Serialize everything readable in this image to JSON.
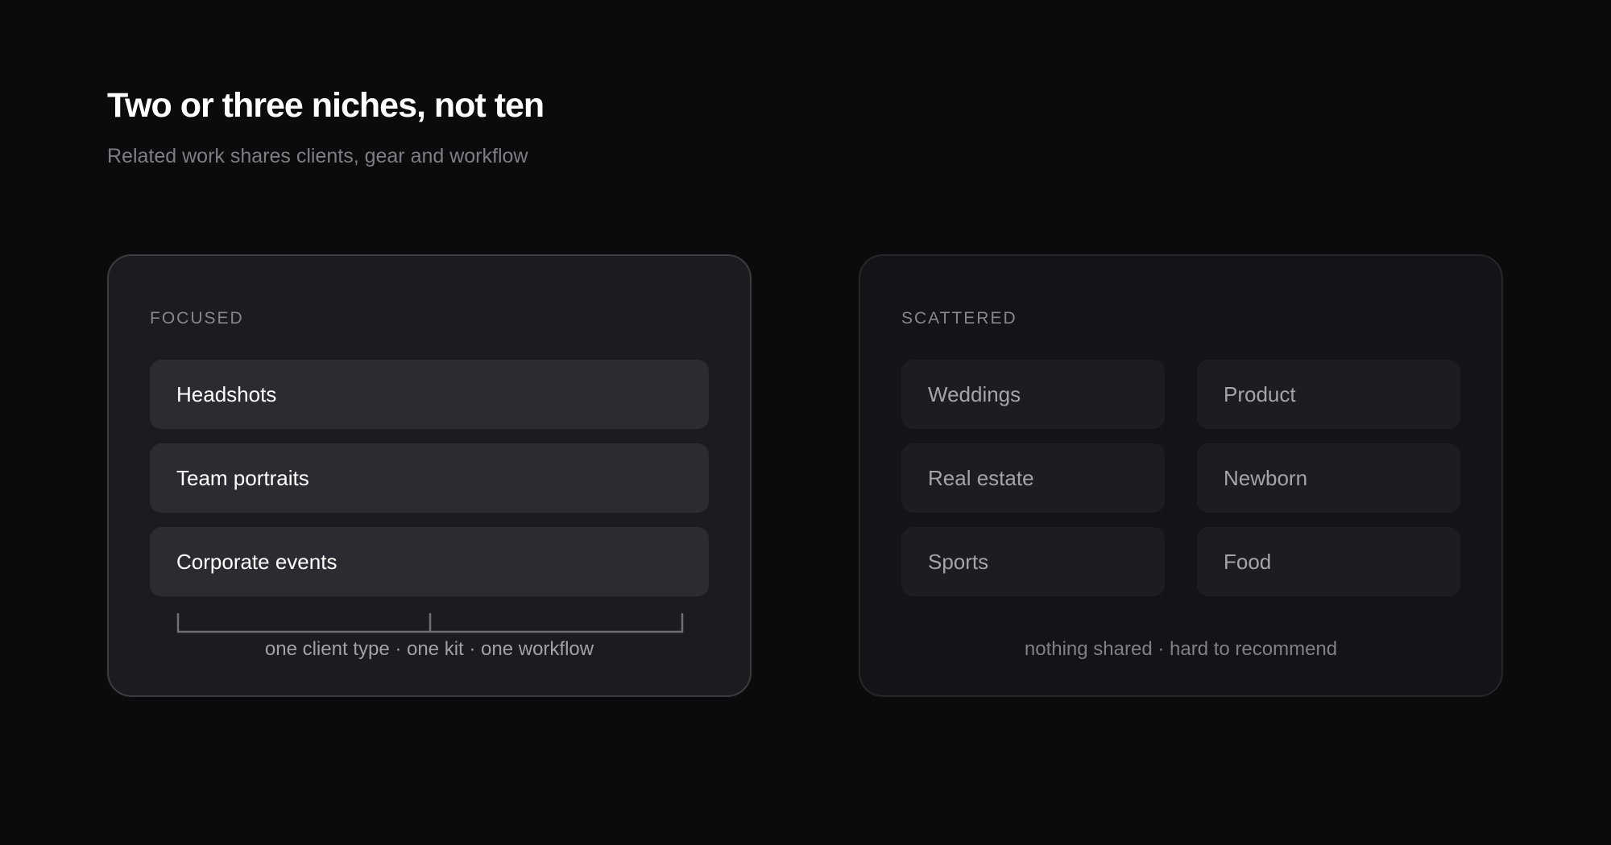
{
  "header": {
    "title": "Two or three niches, not ten",
    "subtitle": "Related work shares clients, gear and workflow"
  },
  "focused": {
    "label": "FOCUSED",
    "items": [
      "Headshots",
      "Team portraits",
      "Corporate events"
    ],
    "caption": "one client type · one kit · one workflow"
  },
  "scattered": {
    "label": "SCATTERED",
    "items": [
      "Weddings",
      "Product",
      "Real estate",
      "Newborn",
      "Sports",
      "Food"
    ],
    "caption": "nothing shared · hard to recommend"
  },
  "colors": {
    "background": "#0b0b0c",
    "focused_panel": "#1b1c20",
    "scattered_panel": "#131417",
    "focused_item": "#2b2c31",
    "scattered_item": "#1c1d21"
  }
}
